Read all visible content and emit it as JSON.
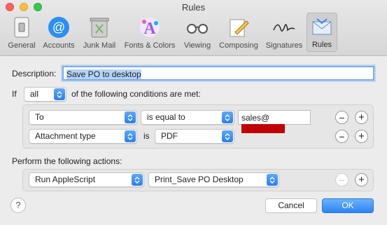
{
  "window": {
    "title": "Rules"
  },
  "colors": {
    "close": "#fc605c",
    "minimize": "#fdbc40",
    "zoom": "#34c84a",
    "accent": "#3b8cf5",
    "redaction": "#c30000"
  },
  "toolbar": {
    "items": [
      {
        "label": "General",
        "icon": "switch-icon"
      },
      {
        "label": "Accounts",
        "icon": "at-sign-icon"
      },
      {
        "label": "Junk Mail",
        "icon": "trash-can-icon"
      },
      {
        "label": "Fonts & Colors",
        "icon": "color-a-icon"
      },
      {
        "label": "Viewing",
        "icon": "glasses-icon"
      },
      {
        "label": "Composing",
        "icon": "pencil-paper-icon"
      },
      {
        "label": "Signatures",
        "icon": "signature-icon"
      },
      {
        "label": "Rules",
        "icon": "rules-envelope-icon",
        "selected": true
      }
    ]
  },
  "description": {
    "label": "Description:",
    "value": "Save PO to desktop"
  },
  "conditions": {
    "prefix": "If",
    "match_value": "all",
    "suffix": "of the following conditions are met:",
    "rows": [
      {
        "field": "To",
        "operator": "is equal to",
        "value": "sales@"
      },
      {
        "field": "Attachment type",
        "operator_text": "is",
        "value": "PDF"
      }
    ]
  },
  "actions": {
    "label": "Perform the following actions:",
    "rows": [
      {
        "action": "Run AppleScript",
        "script": "Print_Save PO Desktop"
      }
    ]
  },
  "buttons": {
    "help": "?",
    "cancel": "Cancel",
    "ok": "OK",
    "remove": "−",
    "add": "+"
  }
}
